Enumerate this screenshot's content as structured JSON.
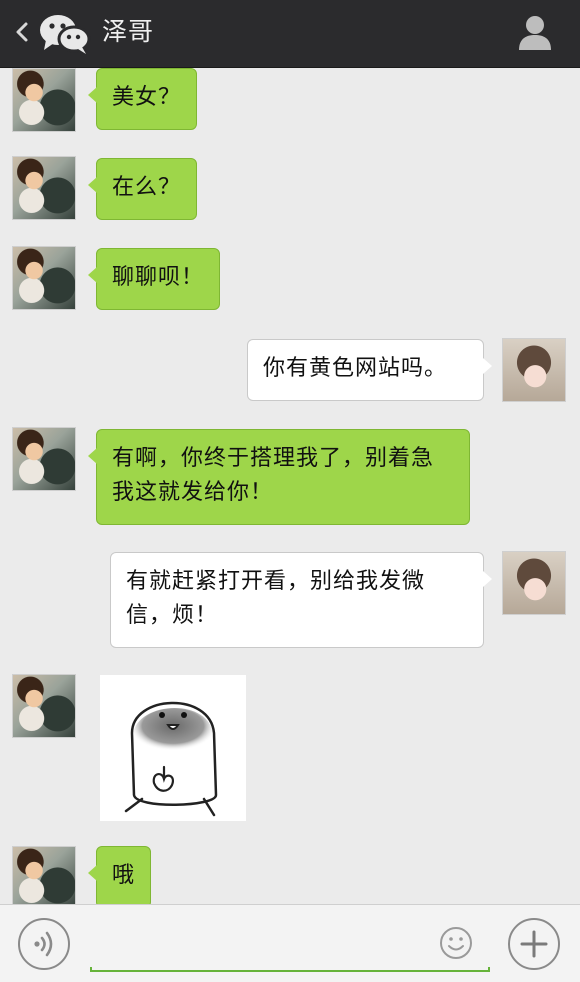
{
  "header": {
    "back_icon": "chevron-left-icon",
    "app_icon": "wechat-icon",
    "title": "泽哥",
    "profile_icon": "person-icon"
  },
  "messages": [
    {
      "sender": "contact",
      "text": "美女？"
    },
    {
      "sender": "contact",
      "text": "在么？"
    },
    {
      "sender": "contact",
      "text": "聊聊呗！"
    },
    {
      "sender": "me",
      "text": "你有黄色网站吗。"
    },
    {
      "sender": "contact",
      "text": "有啊，你终于搭理我了，别着急我这就发给你！"
    },
    {
      "sender": "me",
      "text": "有就赶紧打开看，别给我发微信，烦！"
    },
    {
      "sender": "contact",
      "type": "sticker",
      "icon": "cartoon-sticker-icon"
    },
    {
      "sender": "contact",
      "text": "哦"
    }
  ],
  "input_bar": {
    "voice_icon": "voice-icon",
    "emoji_icon": "smiley-icon",
    "more_icon": "plus-icon"
  },
  "colors": {
    "header_bg": "#2b2b2d",
    "chat_bg": "#ebebeb",
    "incoming_bubble": "#9ed64a",
    "outgoing_bubble": "#ffffff",
    "accent": "#66b33a"
  }
}
